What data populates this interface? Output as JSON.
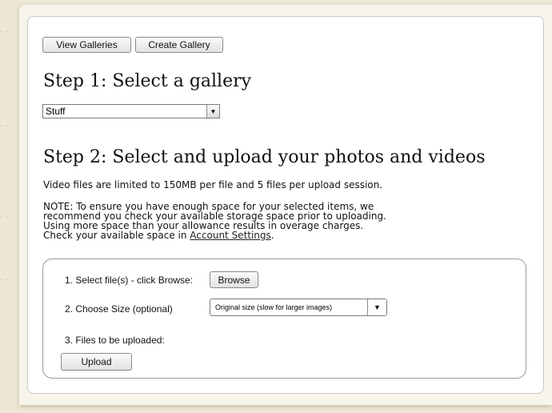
{
  "toolbar": {
    "view_galleries_label": "View Galleries",
    "create_gallery_label": "Create Gallery"
  },
  "step1": {
    "heading": "Step 1: Select a gallery",
    "gallery_select_value": "Stuff"
  },
  "step2": {
    "heading": "Step 2: Select and upload your photos and videos",
    "limit_text": "Video files are limited to 150MB per file and 5 files per upload session.",
    "note_line1": "NOTE: To ensure you have enough space for your selected items, we",
    "note_line2": "recommend you check your available storage space prior to uploading.",
    "note_line3": "Using more space than your allowance results in overage charges.",
    "note_line4_prefix": "Check your available space in",
    "account_settings_link": "Account Settings",
    "note_line4_suffix": "."
  },
  "upload": {
    "select_files_label": "1. Select file(s) - click Browse:",
    "browse_label": "Browse",
    "choose_size_label": "2. Choose Size (optional)",
    "size_select_value": "Original size (slow for larger images)",
    "files_to_upload_label": "3. Files to be uploaded:",
    "upload_button_label": "Upload"
  }
}
